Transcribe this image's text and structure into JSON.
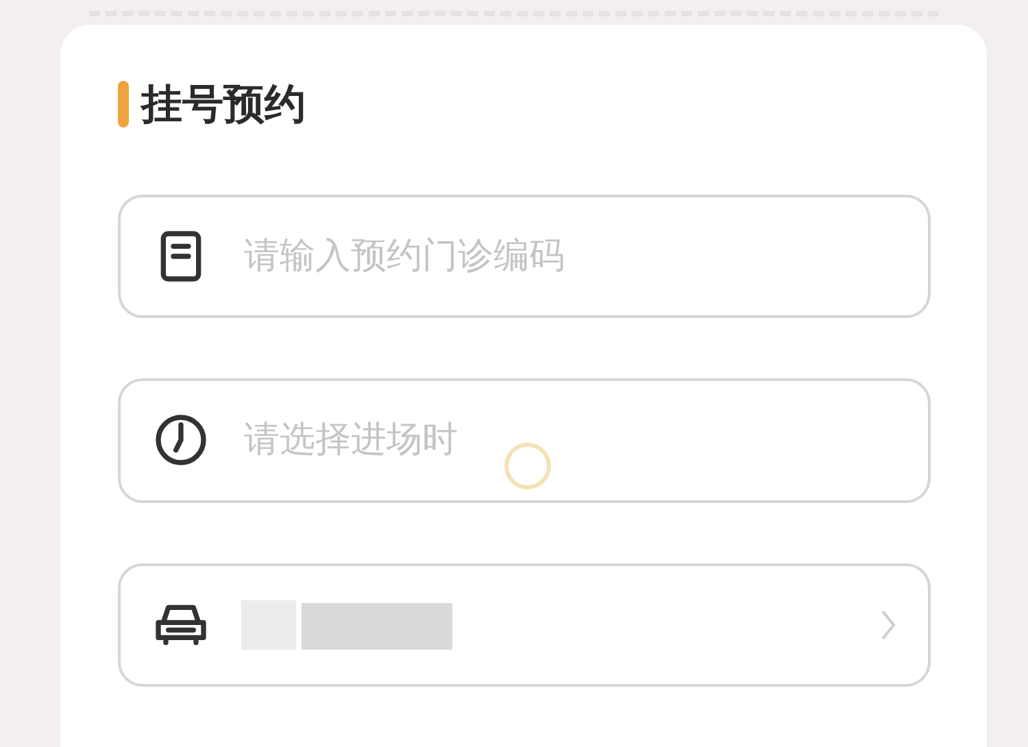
{
  "section": {
    "title": "挂号预约"
  },
  "fields": [
    {
      "kind": "input",
      "placeholder": "请输入预约门诊编码"
    },
    {
      "kind": "input",
      "placeholder": "请选择进场时"
    },
    {
      "kind": "select"
    }
  ]
}
